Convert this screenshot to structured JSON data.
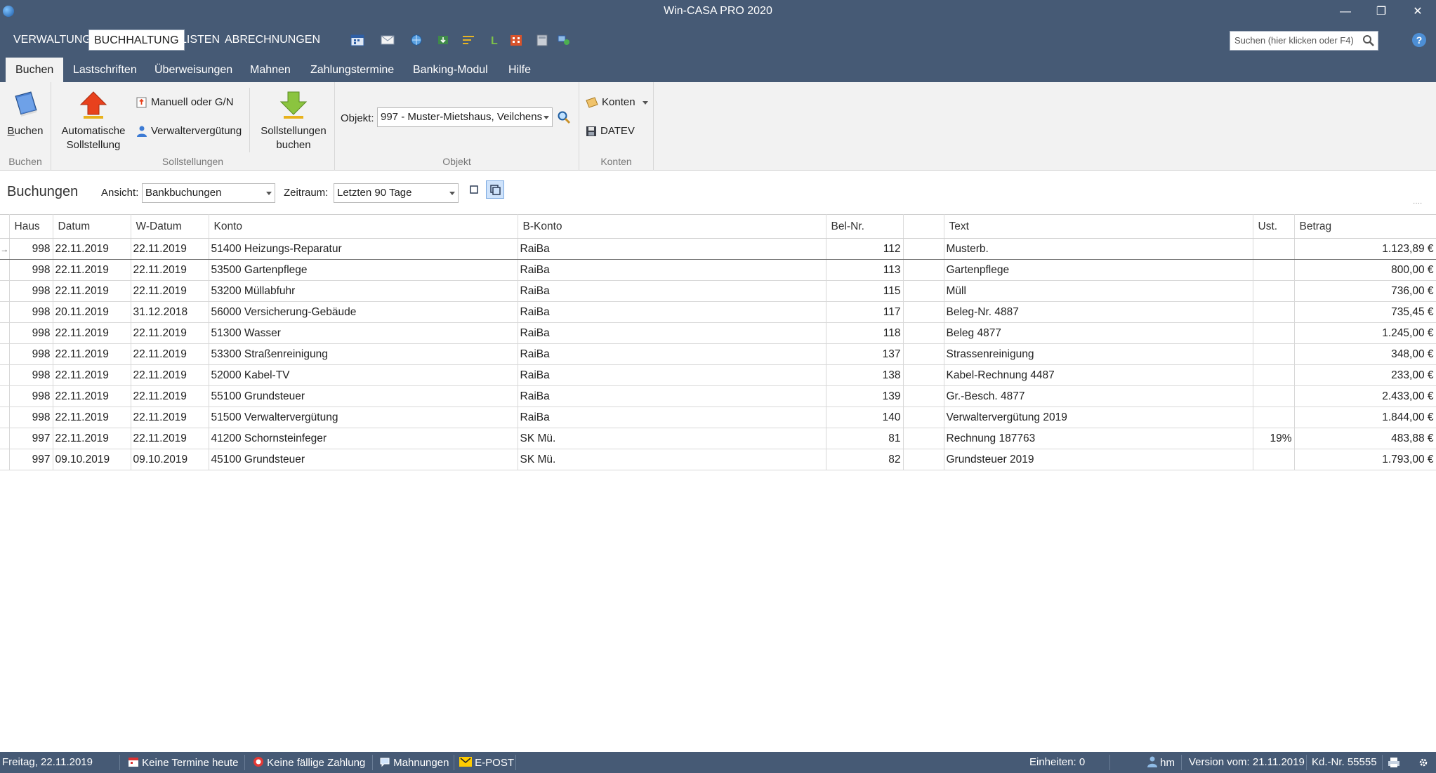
{
  "window": {
    "title": "Win-CASA PRO 2020",
    "minimize": "—",
    "restore": "❐",
    "close": "✕"
  },
  "menu": {
    "items": [
      "VERWALTUNG",
      "BUCHHALTUNG",
      "LISTEN",
      "ABRECHNUNGEN"
    ],
    "active": "BUCHHALTUNG"
  },
  "search": {
    "placeholder": "Suchen (hier klicken oder F4)"
  },
  "ribbon_tabs": {
    "items": [
      "Buchen",
      "Lastschriften",
      "Überweisungen",
      "Mahnen",
      "Zahlungstermine",
      "Banking-Modul",
      "Hilfe"
    ],
    "active": "Buchen"
  },
  "ribbon": {
    "buchen": {
      "button": "Buchen",
      "group": "Buchen"
    },
    "sollstellungen": {
      "auto_line1": "Automatische",
      "auto_line2": "Sollstellung",
      "manuell": "Manuell oder G/N",
      "verwalter": "Verwaltervergütung",
      "buchen_line1": "Sollstellungen",
      "buchen_line2": "buchen",
      "group": "Sollstellungen"
    },
    "objekt": {
      "label": "Objekt:",
      "value": "997 - Muster-Mietshaus, Veilchens",
      "group": "Objekt"
    },
    "konten": {
      "konten": "Konten",
      "datev": "DATEV",
      "group": "Konten"
    }
  },
  "viewbar": {
    "title": "Buchungen",
    "ansicht_label": "Ansicht:",
    "ansicht_value": "Bankbuchungen",
    "zeitraum_label": "Zeitraum:",
    "zeitraum_value": "Letzten 90 Tage",
    "more": "····"
  },
  "table": {
    "columns": [
      "Haus",
      "Datum",
      "W-Datum",
      "Konto",
      "B-Konto",
      "Bel-Nr.",
      "",
      "Text",
      "Ust.",
      "Betrag"
    ],
    "rows": [
      [
        "998",
        "22.11.2019",
        "22.11.2019",
        "51400 Heizungs-Reparatur",
        "RaiBa",
        "112",
        "",
        "Musterb.",
        "",
        "1.123,89 €"
      ],
      [
        "998",
        "22.11.2019",
        "22.11.2019",
        "53500 Gartenpflege",
        "RaiBa",
        "113",
        "",
        "Gartenpflege",
        "",
        "800,00 €"
      ],
      [
        "998",
        "22.11.2019",
        "22.11.2019",
        "53200 Müllabfuhr",
        "RaiBa",
        "115",
        "",
        "Müll",
        "",
        "736,00 €"
      ],
      [
        "998",
        "20.11.2019",
        "31.12.2018",
        "56000 Versicherung-Gebäude",
        "RaiBa",
        "117",
        "",
        "Beleg-Nr. 4887",
        "",
        "735,45 €"
      ],
      [
        "998",
        "22.11.2019",
        "22.11.2019",
        "51300 Wasser",
        "RaiBa",
        "118",
        "",
        "Beleg 4877",
        "",
        "1.245,00 €"
      ],
      [
        "998",
        "22.11.2019",
        "22.11.2019",
        "53300 Straßenreinigung",
        "RaiBa",
        "137",
        "",
        "Strassenreinigung",
        "",
        "348,00 €"
      ],
      [
        "998",
        "22.11.2019",
        "22.11.2019",
        "52000 Kabel-TV",
        "RaiBa",
        "138",
        "",
        "Kabel-Rechnung 4487",
        "",
        "233,00 €"
      ],
      [
        "998",
        "22.11.2019",
        "22.11.2019",
        "55100 Grundsteuer",
        "RaiBa",
        "139",
        "",
        "Gr.-Besch. 4877",
        "",
        "2.433,00 €"
      ],
      [
        "998",
        "22.11.2019",
        "22.11.2019",
        "51500 Verwaltervergütung",
        "RaiBa",
        "140",
        "",
        "Verwaltervergütung 2019",
        "",
        "1.844,00 €"
      ],
      [
        "997",
        "22.11.2019",
        "22.11.2019",
        "41200 Schornsteinfeger",
        "SK Mü.",
        "81",
        "",
        "Rechnung 187763",
        "19%",
        "483,88 €"
      ],
      [
        "997",
        "09.10.2019",
        "09.10.2019",
        "45100 Grundsteuer",
        "SK Mü.",
        "82",
        "",
        "Grundsteuer 2019",
        "",
        "1.793,00 €"
      ]
    ],
    "selected_row": 0,
    "row_indicator": "→"
  },
  "status": {
    "date": "Freitag, 22.11.2019",
    "termine": "Keine Termine heute",
    "zahlung": "Keine fällige Zahlung",
    "mahnungen": "Mahnungen",
    "epost": "E-POST",
    "einheiten": "Einheiten: 0",
    "user": "hm",
    "version": "Version vom: 21.11.2019",
    "kdnr": "Kd.-Nr. 55555"
  },
  "colors": {
    "chrome": "#465a75",
    "ribbon": "#f2f2f2",
    "accent": "#4d8fd6"
  }
}
